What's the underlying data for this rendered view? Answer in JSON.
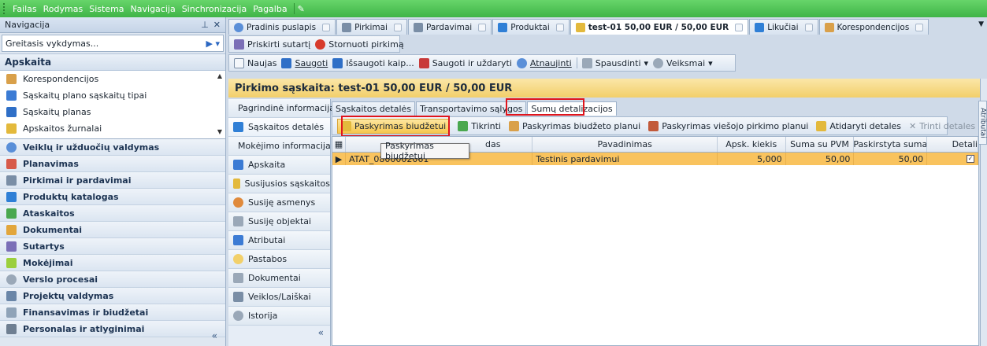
{
  "menubar": {
    "items": [
      "Failas",
      "Rodymas",
      "Sistema",
      "Navigacija",
      "Sinchronizacija",
      "Pagalba"
    ]
  },
  "navigation": {
    "header": "Navigacija",
    "pin": "⊥",
    "close": "✕",
    "quick_placeholder": "Greitasis vykdymas...",
    "section": "Apskaita",
    "top_items": [
      {
        "label": "Korespondencijos",
        "color": "#d9a04a"
      },
      {
        "label": "Sąskaitų plano sąskaitų tipai",
        "color": "#3b7bd4"
      },
      {
        "label": "Sąskaitų planas",
        "color": "#2f6fc7"
      },
      {
        "label": "Apskaitos žurnalai",
        "color": "#e3b93c"
      }
    ],
    "categories": [
      {
        "label": "Veiklų ir užduočių valdymas",
        "color": "#5a8fd8"
      },
      {
        "label": "Planavimas",
        "color": "#d75a4a"
      },
      {
        "label": "Pirkimai ir pardavimai",
        "color": "#7a8ea6"
      },
      {
        "label": "Produktų katalogas",
        "color": "#2f7fd6"
      },
      {
        "label": "Ataskaitos",
        "color": "#4aa84f"
      },
      {
        "label": "Dokumentai",
        "color": "#e2a63c"
      },
      {
        "label": "Sutartys",
        "color": "#7b6fb7"
      },
      {
        "label": "Mokėjimai",
        "color": "#9bcf3d"
      },
      {
        "label": "Verslo procesai",
        "color": "#9aa8b8"
      },
      {
        "label": "Projektų valdymas",
        "color": "#6a86a8"
      },
      {
        "label": "Finansavimas ir biudžetai",
        "color": "#8fa3b8"
      },
      {
        "label": "Personalas ir atlyginimai",
        "color": "#6f7f92"
      }
    ],
    "collapse": "«"
  },
  "doc_tabs": [
    {
      "label": "Pradinis puslapis",
      "color": "#5a8fd8",
      "active": false
    },
    {
      "label": "Pirkimai",
      "color": "#7a8ea6",
      "active": false
    },
    {
      "label": "Pardavimai",
      "color": "#7a8ea6",
      "active": false
    },
    {
      "label": "Produktai",
      "color": "#2f7fd6",
      "active": false
    },
    {
      "label": "test-01 50,00 EUR / 50,00 EUR",
      "color": "#e3b93c",
      "active": true
    },
    {
      "label": "Likučiai",
      "color": "#2f7fd6",
      "active": false
    },
    {
      "label": "Korespondencijos",
      "color": "#d9a04a",
      "active": false
    }
  ],
  "toolbar1": {
    "assign": "Priskirti sutartį",
    "reverse": "Stornuoti pirkimą"
  },
  "toolbar2": {
    "new": "Naujas",
    "save": "Saugoti",
    "save_as": "Išsaugoti kaip...",
    "save_close": "Saugoti ir uždaryti",
    "refresh": "Atnaujinti",
    "print": "Spausdinti",
    "actions": "Veiksmai"
  },
  "page_title": "Pirkimo sąskaita: test-01 50,00 EUR / 50,00 EUR",
  "side_tab": "Atributai",
  "detail_sidebar": [
    {
      "label": "Pagrindinė informacija",
      "color": "#e3b93c"
    },
    {
      "label": "Sąskaitos detalės",
      "color": "#2f7fd6"
    },
    {
      "label": "Mokėjimo informacija",
      "color": "#9bcf3d"
    },
    {
      "label": "Apskaita",
      "color": "#3b7bd4"
    },
    {
      "label": "Susijusios sąskaitos",
      "color": "#e3b93c"
    },
    {
      "label": "Susiję asmenys",
      "color": "#e08a3c"
    },
    {
      "label": "Susiję objektai",
      "color": "#9aa8b8"
    },
    {
      "label": "Atributai",
      "color": "#3b7bd4"
    },
    {
      "label": "Pastabos",
      "color": "#f2d06a"
    },
    {
      "label": "Dokumentai",
      "color": "#9aa8b8"
    },
    {
      "label": "Veiklos/Laiškai",
      "color": "#7a8ea6"
    },
    {
      "label": "Istorija",
      "color": "#9aa8b8"
    }
  ],
  "sub_tabs": [
    {
      "label": "Sąskaitos detalės",
      "active": false
    },
    {
      "label": "Transportavimo sąlygos",
      "active": false
    },
    {
      "label": "Sumų detalizacijos",
      "active": true
    }
  ],
  "actions": {
    "budget": "Paskyrimas biudžetui",
    "check": "Tikrinti",
    "budget_plan": "Paskyrimas biudžeto planui",
    "public_plan": "Paskyrimas viešojo pirkimo planui",
    "open": "Atidaryti detales",
    "delete": "Trinti detales"
  },
  "grid": {
    "columns": [
      "",
      "das",
      "Pavadinimas",
      "Apsk. kiekis",
      "Suma su PVM",
      "Paskirstyta suma",
      "Detali"
    ],
    "rows": [
      {
        "code": "ATAT_0800002061",
        "name": "Testinis pardavimui",
        "qty": "5,000",
        "sum": "50,00",
        "assigned": "50,00",
        "check": "✓"
      }
    ]
  },
  "tooltip": "Paskyrimas biudžetui"
}
